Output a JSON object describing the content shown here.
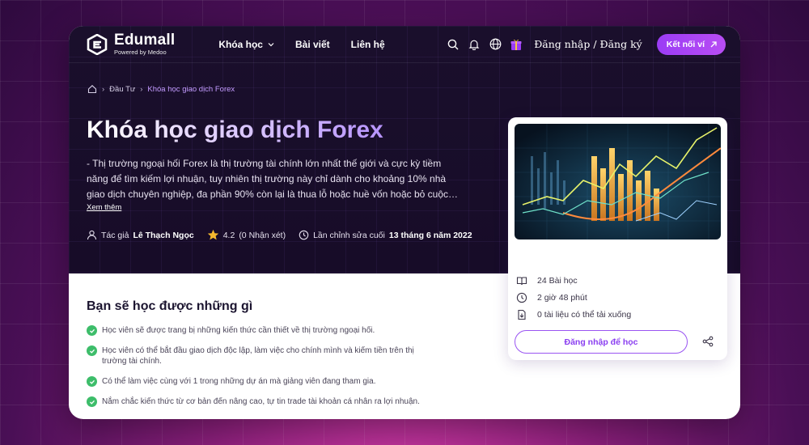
{
  "header": {
    "logo_name": "Edumall",
    "logo_sub": "Powered by Medoo",
    "nav": [
      {
        "label": "Khóa học",
        "has_dropdown": true
      },
      {
        "label": "Bài viết"
      },
      {
        "label": "Liên hệ"
      }
    ],
    "login_label": "Đăng nhập",
    "auth_separator": " / ",
    "register_label": "Đăng ký",
    "connect_wallet_label": "Kết nối ví"
  },
  "breadcrumb": {
    "items": [
      "Đầu Tư",
      "Khóa học giao dịch Forex"
    ]
  },
  "course": {
    "title": "Khóa học giao dịch Forex",
    "description": "- Thị trường ngoại hối Forex là thị trường tài chính lớn nhất thế giới và cực kỳ tiềm năng để tìm kiếm lợi nhuận, tuy nhiên thị trường này chỉ dành cho khoảng 10% nhà giao dịch chuyên nghiệp, đa phần 90% còn lại là thua lỗ hoặc huề vốn hoặc bỏ cuộc sau một thời gian tham gia.",
    "see_more": "Xem thêm",
    "author_prefix": "Tác giả",
    "author": "Lê Thạch Ngọc",
    "rating": "4.2",
    "reviews": "(0 Nhận xét)",
    "updated_prefix": "Lần chỉnh sửa cuối",
    "updated_date": "13 tháng 6 năm 2022"
  },
  "learn": {
    "title": "Bạn sẽ học được những gì",
    "items": [
      "Học viên sẽ được trang bị những kiến thức cần thiết về thị trường ngoại hối.",
      "Học viên có thể bắt đầu giao dịch độc lập, làm việc cho chính mình và kiếm tiền trên thị trường tài chính.",
      "Có thể làm việc cùng với 1 trong những dự án mà giảng viên đang tham gia.",
      "Nắm chắc kiến thức từ cơ bản đến nâng cao, tự tin trade tài khoản cá nhân ra lợi nhuận."
    ]
  },
  "card": {
    "lessons": "24 Bài học",
    "duration": "2 giờ 48 phút",
    "downloads": "0 tài liệu có thể tải xuống",
    "cta": "Đăng nhập để học"
  },
  "colors": {
    "accent": "#9b3cf5",
    "hero_bg": "#1a0f2c",
    "check": "#3dbd6a",
    "star": "#f5b82e"
  },
  "icons": [
    "home-icon",
    "search-icon",
    "bell-icon",
    "globe-icon",
    "gift-icon",
    "arrow-up-right-icon",
    "user-icon",
    "star-icon",
    "clock-history-icon",
    "book-icon",
    "clock-icon",
    "download-file-icon",
    "share-icon",
    "check-circle-icon"
  ]
}
